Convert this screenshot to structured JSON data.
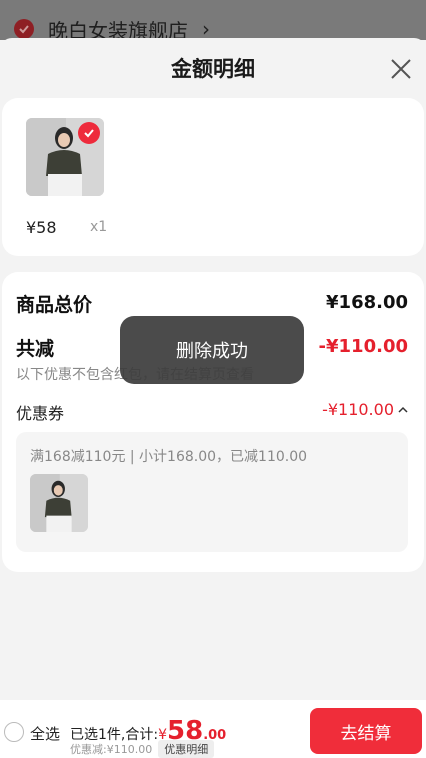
{
  "background": {
    "store_name": "晚白女装旗舰店",
    "chevron": "›"
  },
  "sheet": {
    "title": "金额明细",
    "close_icon": "close-icon"
  },
  "item": {
    "price": "¥58",
    "qty": "x1",
    "selected": true
  },
  "detail": {
    "total_label": "商品总价",
    "total_value": "¥168.00",
    "discount_label": "共减",
    "discount_value": "-¥110.00",
    "note": "以下优惠不包含红包，请在结算页查看",
    "coupon_label": "优惠券",
    "coupon_value": "-¥110.00",
    "coupon_desc": "满168减110元 | 小计168.00，已减110.00"
  },
  "toast": {
    "text": "删除成功"
  },
  "bottom_bar": {
    "select_all": "全选",
    "summary_prefix": "已选1件,合计:",
    "currency": "¥",
    "total_int": "58",
    "total_dec": ".00",
    "discount_line": "优惠减:¥110.00",
    "detail_chip": "优惠明细",
    "checkout_label": "去结算"
  },
  "colors": {
    "accent": "#e5202d",
    "button": "#f02d3a"
  }
}
